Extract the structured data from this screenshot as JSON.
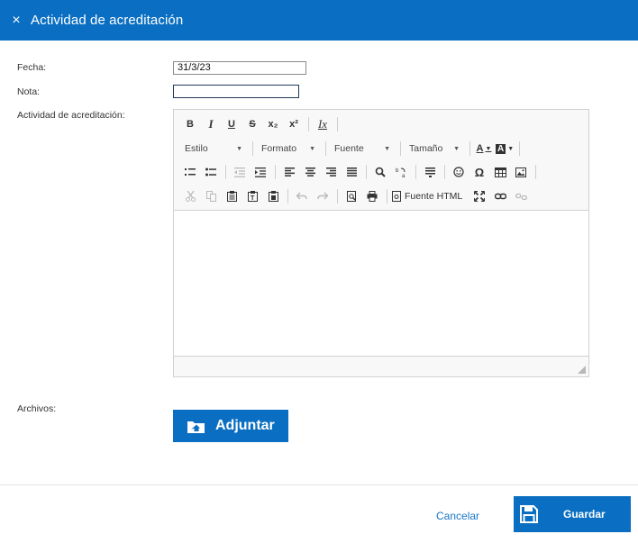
{
  "header": {
    "close": "×",
    "title": "Actividad de acreditación"
  },
  "form": {
    "fecha_label": "Fecha:",
    "fecha_value": "31/3/23",
    "nota_label": "Nota:",
    "nota_value": "",
    "actividad_label": "Actividad de acreditación:",
    "archivos_label": "Archivos:"
  },
  "toolbar": {
    "bold": "B",
    "italic": "I",
    "underline": "U",
    "strike": "S",
    "subscript": "x₂",
    "superscript": "x²",
    "remove_format": "Ix",
    "combo_style": "Estilo",
    "combo_format": "Formato",
    "combo_font": "Fuente",
    "combo_size": "Tamaño",
    "text_color": "A",
    "bg_color": "A",
    "source_label": "Fuente HTML"
  },
  "attach_label": "Adjuntar",
  "footer": {
    "cancel": "Cancelar",
    "save": "Guardar"
  },
  "colors": {
    "primary": "#0a6fc2",
    "link": "#1a76c7"
  }
}
